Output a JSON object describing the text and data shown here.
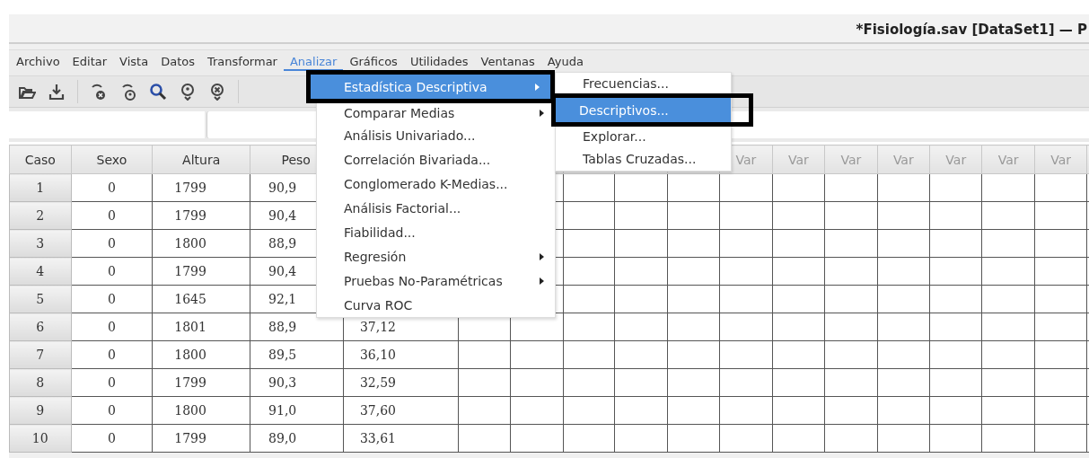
{
  "window": {
    "title": "*Fisiología.sav [DataSet1] — P"
  },
  "menu_bar": [
    {
      "label": "Archivo",
      "selected": false
    },
    {
      "label": "Editar",
      "selected": false
    },
    {
      "label": "Vista",
      "selected": false
    },
    {
      "label": "Datos",
      "selected": false
    },
    {
      "label": "Transformar",
      "selected": false
    },
    {
      "label": "Analizar",
      "selected": true
    },
    {
      "label": "Gráficos",
      "selected": false
    },
    {
      "label": "Utilidades",
      "selected": false
    },
    {
      "label": "Ventanas",
      "selected": false
    },
    {
      "label": "Ayuda",
      "selected": false
    }
  ],
  "analyze_menu": {
    "items": [
      {
        "label": "Estadística Descriptiva",
        "selected": true,
        "submenu": true
      },
      {
        "label": "Comparar Medias",
        "selected": false,
        "submenu": true
      },
      {
        "label": "Análisis Univariado...",
        "selected": false,
        "submenu": false
      },
      {
        "label": "Correlación Bivariada...",
        "selected": false,
        "submenu": false
      },
      {
        "label": "Conglomerado K-Medias...",
        "selected": false,
        "submenu": false
      },
      {
        "label": "Análisis Factorial...",
        "selected": false,
        "submenu": false
      },
      {
        "label": "Fiabilidad...",
        "selected": false,
        "submenu": false
      },
      {
        "label": "Regresión",
        "selected": false,
        "submenu": true
      },
      {
        "label": "Pruebas No-Paramétricas",
        "selected": false,
        "submenu": true
      },
      {
        "label": "Curva ROC",
        "selected": false,
        "submenu": false
      }
    ]
  },
  "descriptive_submenu": {
    "items": [
      {
        "label": "Frecuencias...",
        "selected": false
      },
      {
        "label": "Descriptivos...",
        "selected": true
      },
      {
        "label": "Explorar...",
        "selected": false
      },
      {
        "label": "Tablas Cruzadas...",
        "selected": false
      }
    ]
  },
  "table": {
    "columns": [
      "Caso",
      "Sexo",
      "Altura",
      "Peso"
    ],
    "var_columns": [
      "Var",
      "Var",
      "Var",
      "Var",
      "Var",
      "Var",
      "Var"
    ],
    "rows": [
      {
        "caso": "1",
        "sexo": "0",
        "altura": "1799",
        "peso": "90,9"
      },
      {
        "caso": "2",
        "sexo": "0",
        "altura": "1799",
        "peso": "90,4"
      },
      {
        "caso": "3",
        "sexo": "0",
        "altura": "1800",
        "peso": "88,9"
      },
      {
        "caso": "4",
        "sexo": "0",
        "altura": "1799",
        "peso": "90,4"
      },
      {
        "caso": "5",
        "sexo": "0",
        "altura": "1645",
        "peso": "92,1"
      },
      {
        "caso": "6",
        "sexo": "0",
        "altura": "1801",
        "peso": "88,9",
        "column_5": "37,12"
      },
      {
        "caso": "7",
        "sexo": "0",
        "altura": "1800",
        "peso": "89,5",
        "column_5": "36,10"
      },
      {
        "caso": "8",
        "sexo": "0",
        "altura": "1799",
        "peso": "90,3",
        "column_5": "32,59"
      },
      {
        "caso": "9",
        "sexo": "0",
        "altura": "1800",
        "peso": "91,0",
        "column_5": "37,60"
      },
      {
        "caso": "10",
        "sexo": "0",
        "altura": "1799",
        "peso": "89,0",
        "column_5": "33,61"
      }
    ]
  }
}
